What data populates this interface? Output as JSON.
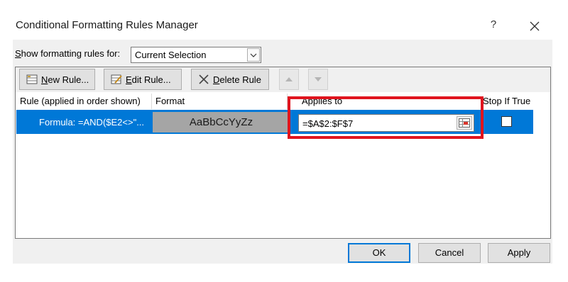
{
  "dialog": {
    "title": "Conditional Formatting Rules Manager",
    "help_label": "?"
  },
  "show_rules": {
    "label_prefix": "S",
    "label_rest": "how formatting rules for:",
    "selected": "Current Selection"
  },
  "toolbar": {
    "new_rule_u": "N",
    "new_rule_rest": "ew Rule...",
    "edit_rule_u": "E",
    "edit_rule_rest": "dit Rule...",
    "delete_rule_u": "D",
    "delete_rule_rest": "elete Rule"
  },
  "columns": {
    "rule": "Rule (applied in order shown)",
    "format": "Format",
    "applies_to": "Applies to",
    "stop_if_true": "Stop If True"
  },
  "rules": [
    {
      "rule": "Formula: =AND($E2<>\"...",
      "format_preview": "AaBbCcYyZz",
      "applies_to": "=$A$2:$F$7",
      "stop_if_true": false
    }
  ],
  "buttons": {
    "ok": "OK",
    "cancel": "Cancel",
    "apply": "Apply"
  },
  "colors": {
    "selection": "#0078d7",
    "highlight": "#e0141e",
    "format_fill": "#a5a5a5"
  }
}
